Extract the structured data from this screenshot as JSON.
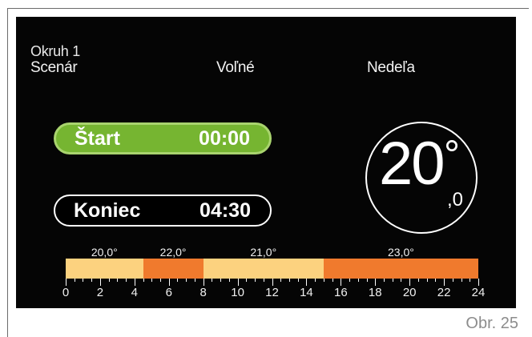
{
  "circuit_label": "Okruh 1",
  "header": {
    "scenario_label": "Scenár",
    "mode_label": "Voľné",
    "day_label": "Nedeľa"
  },
  "start": {
    "label": "Štart",
    "time": "00:00",
    "color": "#76b531"
  },
  "end": {
    "label": "Koniec",
    "time": "04:30"
  },
  "temperature": {
    "integer": "20",
    "degree": "°",
    "decimal": ",0"
  },
  "schedule": {
    "colors": {
      "comfort_low": "#fcd27f",
      "comfort_high": "#f07a2d"
    },
    "segments": [
      {
        "label": "20,0°",
        "from_hour": 0,
        "to_hour": 4.5,
        "color": "#fcd27f"
      },
      {
        "label": "22,0°",
        "from_hour": 4.5,
        "to_hour": 8,
        "color": "#f07a2d"
      },
      {
        "label": "21,0°",
        "from_hour": 8,
        "to_hour": 15,
        "color": "#fcd27f"
      },
      {
        "label": "23,0°",
        "from_hour": 15,
        "to_hour": 24,
        "color": "#f07a2d"
      }
    ],
    "hour_labels": [
      "0",
      "2",
      "4",
      "6",
      "8",
      "10",
      "12",
      "14",
      "16",
      "18",
      "20",
      "22",
      "24"
    ]
  },
  "figure_caption": "Obr. 25"
}
